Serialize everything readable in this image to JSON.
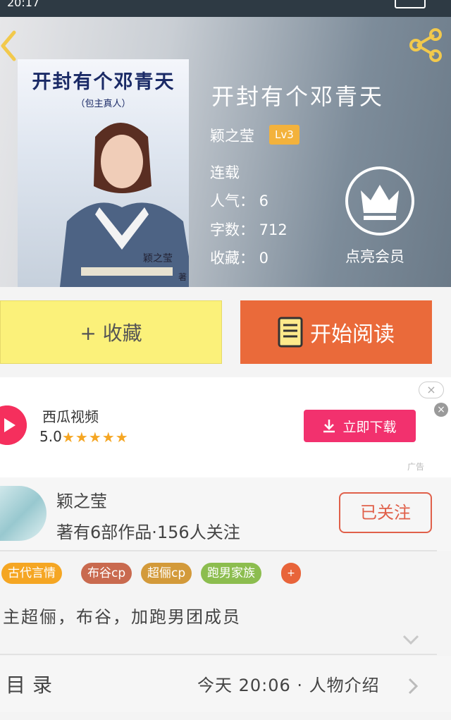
{
  "status_bar": {
    "time": "20:17",
    "left_icons": "ıll",
    "right_icons": "⚐ ⌔"
  },
  "book": {
    "title": "开封有个邓青天",
    "cover_title": "开封有个邓青天",
    "cover_subtitle": "（包主真人）",
    "cover_author": "颖之莹",
    "cover_author_suffix": "著",
    "author": "颖之莹",
    "level": "Lv3",
    "status": "连载",
    "popularity": "人气： 6",
    "word_count": "字数： 712",
    "favorites": "收藏： 0",
    "vip_label": "点亮会员"
  },
  "actions": {
    "favorite_label": "+ 收藏",
    "read_label": "开始阅读"
  },
  "ad": {
    "app_name": "西瓜视频",
    "rating": "5.0",
    "stars": "★★★★★",
    "download_label": "立即下载",
    "ad_tag": "广告",
    "close_symbol": "×"
  },
  "author_card": {
    "name": "颖之莹",
    "stats": "著有6部作品·156人关注",
    "follow_label": "已关注"
  },
  "tags": [
    {
      "label": "古代言情",
      "color": "#f5a623"
    },
    {
      "label": "布谷cp",
      "color": "#c96a4f"
    },
    {
      "label": "超俪cp",
      "color": "#d39a3a"
    },
    {
      "label": "跑男家族",
      "color": "#8cbd4f"
    }
  ],
  "tag_more": "+",
  "summary": "主超俪，布谷，加跑男团成员",
  "toc": {
    "label": "目录",
    "latest": "今天 20:06 · 人物介绍"
  },
  "colors": {
    "accent_orange": "#ea6a3a",
    "favorite_yellow": "#fbf17a",
    "download_pink": "#f2316e"
  },
  "icons": [
    "back-icon",
    "share-icon",
    "crown-icon",
    "book-icon",
    "download-icon",
    "play-logo-icon",
    "chevron-down-icon",
    "chevron-right-icon"
  ]
}
